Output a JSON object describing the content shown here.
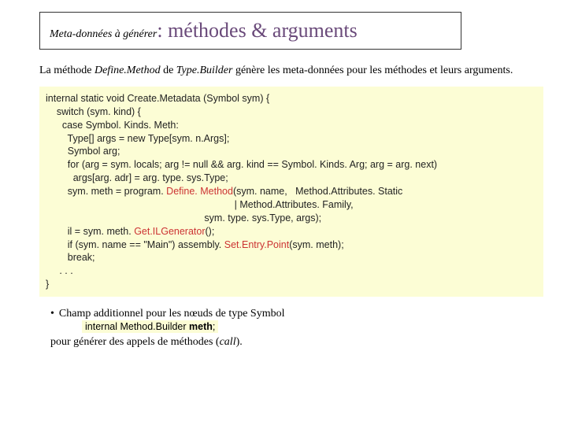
{
  "title": {
    "prefix": "Meta-données à générer",
    "sep": ": ",
    "main": "méthodes & arguments"
  },
  "intro": {
    "t1": "La méthode ",
    "m1": "Define.Method",
    "t2": " de ",
    "m2": "Type.Builder",
    "t3": " génère les meta-données pour les méthodes et leurs arguments."
  },
  "code": {
    "l1": "internal static void Create.Metadata (Symbol sym) {",
    "l2": "    switch (sym. kind) {",
    "l3": "      case Symbol. Kinds. Meth:",
    "l4": "        Type[] args = new Type[sym. n.Args];",
    "l5": "        Symbol arg;",
    "l6": "        for (arg = sym. locals; arg != null && arg. kind == Symbol. Kinds. Arg; arg = arg. next)",
    "l7": "          args[arg. adr] = arg. type. sys.Type;",
    "l8a": "        sym. meth = program. ",
    "l8b": "Define. Method",
    "l8c": "(sym. name,   Method.Attributes. Static",
    "l9": "                                                                     | Method.Attributes. Family,",
    "l10": "                                                          sym. type. sys.Type, args);",
    "l11a": "        il = sym. meth. ",
    "l11b": "Get.ILGenerator",
    "l11c": "();",
    "l12a": "        if (sym. name == \"Main\") assembly. ",
    "l12b": "Set.Entry.Point",
    "l12c": "(sym. meth);",
    "l13": "        break;",
    "l14": "     . . .",
    "l15": "}"
  },
  "bullet": {
    "text": "Champ additionnel pour les nœuds de type Symbol",
    "inline_a": "internal Method.Builder ",
    "inline_b": "meth",
    "inline_c": ";",
    "after_a": "pour générer des appels de méthodes (",
    "after_b": "call",
    "after_c": ")."
  }
}
